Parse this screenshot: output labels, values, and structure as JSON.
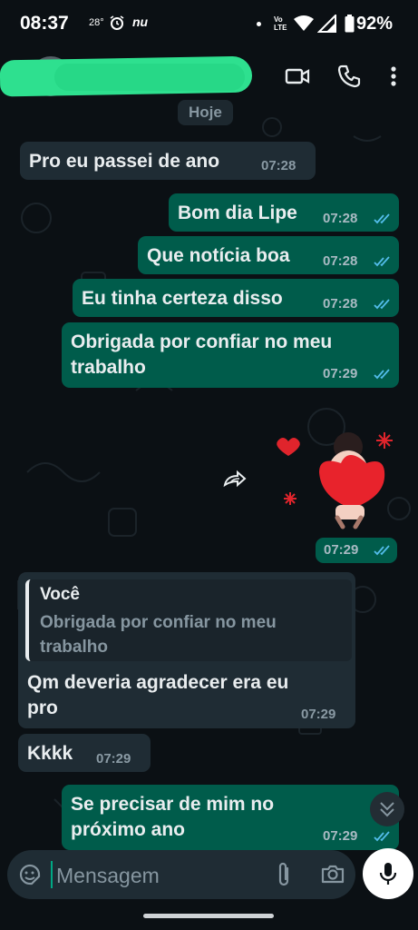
{
  "status_bar": {
    "time": "08:37",
    "temp": "28°",
    "app_label": "nu",
    "volte_line1": "Vo",
    "volte_line2": "LTE",
    "battery": "92%"
  },
  "header": {
    "contact_name": "",
    "icons": [
      "back-icon",
      "avatar",
      "video-call-icon",
      "voice-call-icon",
      "more-options-icon"
    ]
  },
  "chat": {
    "date_label": "Hoje",
    "messages": [
      {
        "direction": "in",
        "text": "Pro eu passei de ano",
        "time": "07:28"
      },
      {
        "direction": "out",
        "text": "Bom dia Lipe",
        "time": "07:28",
        "status": "read"
      },
      {
        "direction": "out",
        "text": "Que notícia boa",
        "time": "07:28",
        "status": "read"
      },
      {
        "direction": "out",
        "text": "Eu tinha certeza disso",
        "time": "07:28",
        "status": "read"
      },
      {
        "direction": "out",
        "text": "Obrigada por confiar no meu\ntrabalho",
        "time": "07:29",
        "status": "read"
      },
      {
        "direction": "out",
        "type": "sticker",
        "time": "07:29",
        "status": "read"
      },
      {
        "direction": "in",
        "quote_author": "Você",
        "quote_text": "Obrigada por confiar no meu\ntrabalho",
        "text": "Qm deveria agradecer era eu\npro",
        "time": "07:29"
      },
      {
        "direction": "in",
        "text": "Kkkk",
        "time": "07:29"
      },
      {
        "direction": "out",
        "text": "Se precisar de mim no\npróximo ano",
        "time": "07:29",
        "status": "read"
      }
    ]
  },
  "input": {
    "placeholder": "Mensagem"
  },
  "colors": {
    "background": "#0b1014",
    "incoming_bubble": "#1f2c34",
    "outgoing_bubble": "#005c4b",
    "read_ticks": "#53bdeb",
    "accent": "#00a884",
    "redaction": "#2ee08f"
  }
}
